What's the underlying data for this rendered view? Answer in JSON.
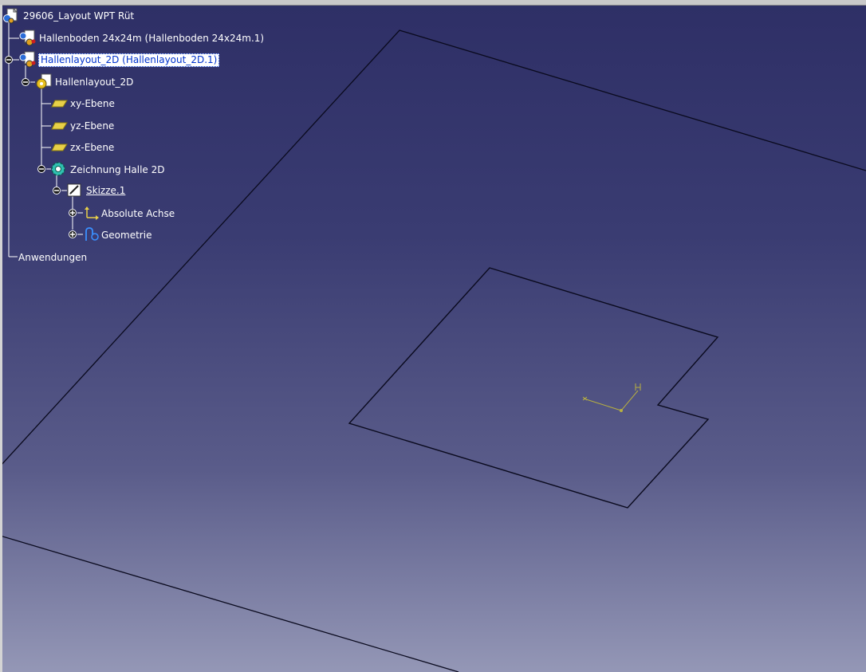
{
  "tree": {
    "root": {
      "label": "29606_Layout WPT Rüt"
    },
    "items": [
      {
        "label": "Hallenboden 24x24m (Hallenboden 24x24m.1)"
      },
      {
        "label": "Hallenlayout_2D (Hallenlayout_2D.1)",
        "selected": true
      },
      {
        "label": "Hallenlayout_2D"
      },
      {
        "label": "xy-Ebene"
      },
      {
        "label": "yz-Ebene"
      },
      {
        "label": "zx-Ebene"
      },
      {
        "label": "Zeichnung Halle 2D"
      },
      {
        "label": "Skizze.1"
      },
      {
        "label": "Absolute Achse"
      },
      {
        "label": "Geometrie"
      }
    ],
    "applications": {
      "label": "Anwendungen"
    }
  },
  "colors": {
    "tree_line": "#ffffff",
    "selection_bg": "#ffffff",
    "selection_text": "#0033cc",
    "geometry_line": "#0a0a1e",
    "axis": "#b8b040",
    "plane_icon": "#e8d048"
  },
  "icons": {
    "root": "product-icon",
    "item_0": "part-instance-icon",
    "item_1": "part-instance-icon",
    "item_2": "part-gear-icon",
    "item_3": "plane-icon",
    "item_4": "plane-icon",
    "item_5": "plane-icon",
    "item_6": "body-gear-icon",
    "item_7": "sketch-icon",
    "item_8": "axis-icon",
    "item_9": "geometry-icon"
  }
}
